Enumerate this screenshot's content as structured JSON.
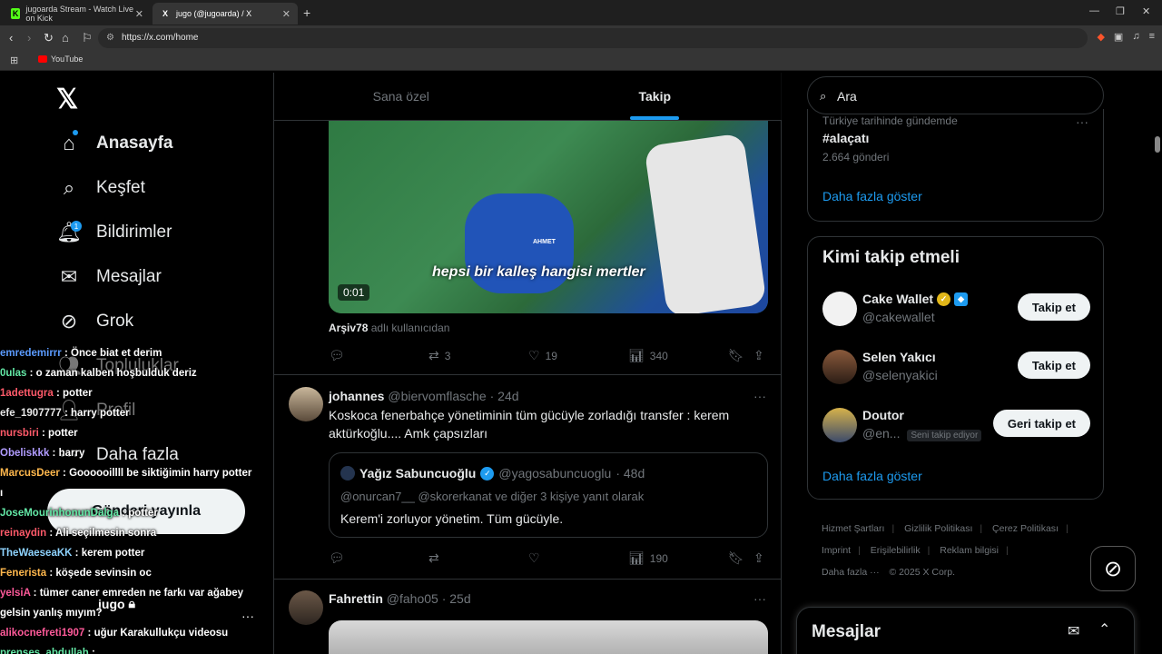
{
  "browser": {
    "tabs": [
      {
        "title": "jugoarda Stream - Watch Live on Kick",
        "favicon": "K"
      },
      {
        "title": "jugo (@jugoarda) / X",
        "favicon": "X"
      }
    ],
    "url": "https://x.com/home",
    "bookmark": "YouTube"
  },
  "sidebar": {
    "items": [
      {
        "label": "Anasayfa"
      },
      {
        "label": "Keşfet"
      },
      {
        "label": "Bildirimler",
        "badge": "1"
      },
      {
        "label": "Mesajlar"
      },
      {
        "label": "Grok"
      },
      {
        "label": "Topluluklar"
      },
      {
        "label": "Profil"
      },
      {
        "label": "Daha fazla"
      }
    ],
    "post_button": "Gönderi yayınla",
    "profile_name": "jugo"
  },
  "chat": [
    {
      "user": "emredemirrr",
      "color": "#5b9bff",
      "msg": ": Önce biat et derim"
    },
    {
      "user": "0ulas",
      "color": "#63e8a6",
      "msg": ": o zaman kalben hoşbulduk deriz"
    },
    {
      "user": "1adettugra",
      "color": "#ff5a6a",
      "msg": ": potter"
    },
    {
      "user": "efe_1907777",
      "color": "#e8e8e8",
      "msg": ": harry potter"
    },
    {
      "user": "nursbiri",
      "color": "#ff5a6a",
      "msg": ": potter"
    },
    {
      "user": "Obeliskkk",
      "color": "#b19cff",
      "msg": ": harry"
    },
    {
      "user": "MarcusDeer",
      "color": "#ffb84d",
      "msg": ": Goooooillll be siktiğimin harry potter"
    },
    {
      "user": "",
      "color": "#ffffff",
      "msg": "ı"
    },
    {
      "user": "JoseMourinhonunDalga",
      "color": "#63e8a6",
      "msg": ": potter"
    },
    {
      "user": "reinaydin",
      "color": "#ff5a6a",
      "msg": ": Ali seçilmesin sonra"
    },
    {
      "user": "TheWaeseaKK",
      "color": "#8fd4ff",
      "msg": ": kerem potter"
    },
    {
      "user": "Fenerista",
      "color": "#ffb84d",
      "msg": ": köşede sevinsin oc"
    },
    {
      "user": "yelsiA",
      "color": "#ff5a9a",
      "msg": ": tümer caner emreden ne farkı var ağabey"
    },
    {
      "user": "",
      "color": "#ffffff",
      "msg": "gelsin yanlış mıyım?"
    },
    {
      "user": "alikocnefreti1907",
      "color": "#ff5a9a",
      "msg": ": uğur Karakullukçu videosu"
    },
    {
      "user": "prenses_abdullah",
      "color": "#63e8a6",
      "msg": ":"
    }
  ],
  "feed": {
    "tabs": [
      "Sana özel",
      "Takip"
    ],
    "post1": {
      "video_caption": "hepsi bir kalleş hangisi mertler",
      "video_watermark": "AHMET",
      "video_time": "0:01",
      "attribution_user": "Arşiv78",
      "attribution_text": "adlı kullanıcıdan",
      "retweets": "3",
      "likes": "19",
      "views": "340"
    },
    "post2": {
      "name": "johannes",
      "handle": "@biervomflasche",
      "time": "· 24d",
      "text": "Koskoca fenerbahçe yönetiminin tüm gücüyle zorladığı transfer : kerem aktürkoğlu.... Amk çapsızları",
      "quote": {
        "name": "Yağız Sabuncuoğlu",
        "handle": "@yagosabuncuoglu",
        "time": "· 48d",
        "reply": "@onurcan7__ @skorerkanat  ve diğer 3 kişiye yanıt olarak",
        "text": "Kerem'i zorluyor yönetim. Tüm gücüyle."
      },
      "views": "190"
    },
    "post3": {
      "name": "Fahrettin",
      "handle": "@faho05",
      "time": "· 25d"
    }
  },
  "right": {
    "search_placeholder": "Ara",
    "trend": {
      "context": "Türkiye tarihinde gündemde",
      "name": "#alaçatı",
      "count": "2.664 gönderi"
    },
    "show_more": "Daha fazla göster",
    "who_title": "Kimi takip etmeli",
    "who": [
      {
        "name": "Cake Wallet",
        "handle": "@cakewallet",
        "button": "Takip et",
        "badge": ""
      },
      {
        "name": "Selen Yakıcı",
        "handle": "@selenyakici",
        "button": "Takip et",
        "badge": ""
      },
      {
        "name": "Doutor",
        "handle": "@en...",
        "button": "Geri takip et",
        "badge": "Seni takip ediyor"
      }
    ],
    "footer": [
      "Hizmet Şartları",
      "Gizlilik Politikası",
      "Çerez Politikası",
      "Imprint",
      "Erişilebilirlik",
      "Reklam bilgisi",
      "Daha fazla ···",
      "© 2025 X Corp."
    ],
    "messages_title": "Mesajlar"
  }
}
